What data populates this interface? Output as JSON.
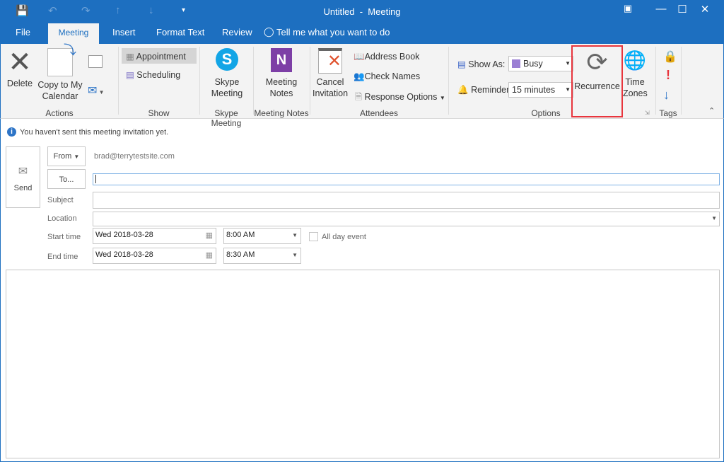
{
  "window": {
    "title": "Untitled  -  Meeting"
  },
  "tabs": [
    {
      "label": "File"
    },
    {
      "label": "Meeting"
    },
    {
      "label": "Insert"
    },
    {
      "label": "Format Text"
    },
    {
      "label": "Review"
    }
  ],
  "tell_me": "Tell me what you want to do",
  "ribbon": {
    "actions": {
      "delete": "Delete",
      "copy": "Copy to My Calendar",
      "group": "Actions"
    },
    "show": {
      "appointment": "Appointment",
      "scheduling": "Scheduling",
      "group": "Show"
    },
    "skype": {
      "label": "Skype Meeting",
      "group": "Skype Meeting"
    },
    "notes": {
      "label": "Meeting Notes",
      "group": "Meeting Notes"
    },
    "attendees": {
      "cancel": "Cancel Invitation",
      "address_book": "Address Book",
      "check_names": "Check Names",
      "response_options": "Response Options",
      "group": "Attendees"
    },
    "options": {
      "show_as_label": "Show As:",
      "show_as_value": "Busy",
      "busy_color": "#9b7fd4",
      "reminder_label": "Reminder:",
      "reminder_value": "15 minutes",
      "recurrence": "Recurrence",
      "time_zones": "Time Zones",
      "group": "Options",
      "highlight_color": "#e8353d"
    },
    "tags": {
      "group": "Tags"
    }
  },
  "form": {
    "info": "You haven't sent this meeting invitation yet.",
    "send": "Send",
    "from_button": "From",
    "from_value": "brad@terrytestsite.com",
    "to_button": "To...",
    "to_value": "",
    "subject_label": "Subject",
    "subject_value": "",
    "location_label": "Location",
    "location_value": "",
    "start_label": "Start time",
    "start_date": "Wed 2018-03-28",
    "start_time": "8:00 AM",
    "all_day": "All day event",
    "end_label": "End time",
    "end_date": "Wed 2018-03-28",
    "end_time": "8:30 AM",
    "body": ""
  }
}
